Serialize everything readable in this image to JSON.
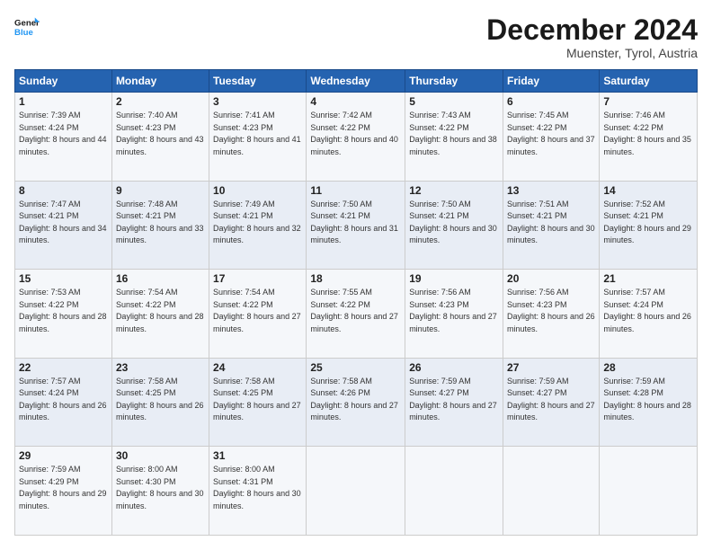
{
  "logo": {
    "line1": "General",
    "line2": "Blue"
  },
  "header": {
    "month": "December 2024",
    "location": "Muenster, Tyrol, Austria"
  },
  "weekdays": [
    "Sunday",
    "Monday",
    "Tuesday",
    "Wednesday",
    "Thursday",
    "Friday",
    "Saturday"
  ],
  "weeks": [
    [
      {
        "day": "1",
        "sunrise": "7:39 AM",
        "sunset": "4:24 PM",
        "daylight": "8 hours and 44 minutes."
      },
      {
        "day": "2",
        "sunrise": "7:40 AM",
        "sunset": "4:23 PM",
        "daylight": "8 hours and 43 minutes."
      },
      {
        "day": "3",
        "sunrise": "7:41 AM",
        "sunset": "4:23 PM",
        "daylight": "8 hours and 41 minutes."
      },
      {
        "day": "4",
        "sunrise": "7:42 AM",
        "sunset": "4:22 PM",
        "daylight": "8 hours and 40 minutes."
      },
      {
        "day": "5",
        "sunrise": "7:43 AM",
        "sunset": "4:22 PM",
        "daylight": "8 hours and 38 minutes."
      },
      {
        "day": "6",
        "sunrise": "7:45 AM",
        "sunset": "4:22 PM",
        "daylight": "8 hours and 37 minutes."
      },
      {
        "day": "7",
        "sunrise": "7:46 AM",
        "sunset": "4:22 PM",
        "daylight": "8 hours and 35 minutes."
      }
    ],
    [
      {
        "day": "8",
        "sunrise": "7:47 AM",
        "sunset": "4:21 PM",
        "daylight": "8 hours and 34 minutes."
      },
      {
        "day": "9",
        "sunrise": "7:48 AM",
        "sunset": "4:21 PM",
        "daylight": "8 hours and 33 minutes."
      },
      {
        "day": "10",
        "sunrise": "7:49 AM",
        "sunset": "4:21 PM",
        "daylight": "8 hours and 32 minutes."
      },
      {
        "day": "11",
        "sunrise": "7:50 AM",
        "sunset": "4:21 PM",
        "daylight": "8 hours and 31 minutes."
      },
      {
        "day": "12",
        "sunrise": "7:50 AM",
        "sunset": "4:21 PM",
        "daylight": "8 hours and 30 minutes."
      },
      {
        "day": "13",
        "sunrise": "7:51 AM",
        "sunset": "4:21 PM",
        "daylight": "8 hours and 30 minutes."
      },
      {
        "day": "14",
        "sunrise": "7:52 AM",
        "sunset": "4:21 PM",
        "daylight": "8 hours and 29 minutes."
      }
    ],
    [
      {
        "day": "15",
        "sunrise": "7:53 AM",
        "sunset": "4:22 PM",
        "daylight": "8 hours and 28 minutes."
      },
      {
        "day": "16",
        "sunrise": "7:54 AM",
        "sunset": "4:22 PM",
        "daylight": "8 hours and 28 minutes."
      },
      {
        "day": "17",
        "sunrise": "7:54 AM",
        "sunset": "4:22 PM",
        "daylight": "8 hours and 27 minutes."
      },
      {
        "day": "18",
        "sunrise": "7:55 AM",
        "sunset": "4:22 PM",
        "daylight": "8 hours and 27 minutes."
      },
      {
        "day": "19",
        "sunrise": "7:56 AM",
        "sunset": "4:23 PM",
        "daylight": "8 hours and 27 minutes."
      },
      {
        "day": "20",
        "sunrise": "7:56 AM",
        "sunset": "4:23 PM",
        "daylight": "8 hours and 26 minutes."
      },
      {
        "day": "21",
        "sunrise": "7:57 AM",
        "sunset": "4:24 PM",
        "daylight": "8 hours and 26 minutes."
      }
    ],
    [
      {
        "day": "22",
        "sunrise": "7:57 AM",
        "sunset": "4:24 PM",
        "daylight": "8 hours and 26 minutes."
      },
      {
        "day": "23",
        "sunrise": "7:58 AM",
        "sunset": "4:25 PM",
        "daylight": "8 hours and 26 minutes."
      },
      {
        "day": "24",
        "sunrise": "7:58 AM",
        "sunset": "4:25 PM",
        "daylight": "8 hours and 27 minutes."
      },
      {
        "day": "25",
        "sunrise": "7:58 AM",
        "sunset": "4:26 PM",
        "daylight": "8 hours and 27 minutes."
      },
      {
        "day": "26",
        "sunrise": "7:59 AM",
        "sunset": "4:27 PM",
        "daylight": "8 hours and 27 minutes."
      },
      {
        "day": "27",
        "sunrise": "7:59 AM",
        "sunset": "4:27 PM",
        "daylight": "8 hours and 27 minutes."
      },
      {
        "day": "28",
        "sunrise": "7:59 AM",
        "sunset": "4:28 PM",
        "daylight": "8 hours and 28 minutes."
      }
    ],
    [
      {
        "day": "29",
        "sunrise": "7:59 AM",
        "sunset": "4:29 PM",
        "daylight": "8 hours and 29 minutes."
      },
      {
        "day": "30",
        "sunrise": "8:00 AM",
        "sunset": "4:30 PM",
        "daylight": "8 hours and 30 minutes."
      },
      {
        "day": "31",
        "sunrise": "8:00 AM",
        "sunset": "4:31 PM",
        "daylight": "8 hours and 30 minutes."
      },
      null,
      null,
      null,
      null
    ]
  ],
  "labels": {
    "sunrise": "Sunrise:",
    "sunset": "Sunset:",
    "daylight": "Daylight:"
  }
}
